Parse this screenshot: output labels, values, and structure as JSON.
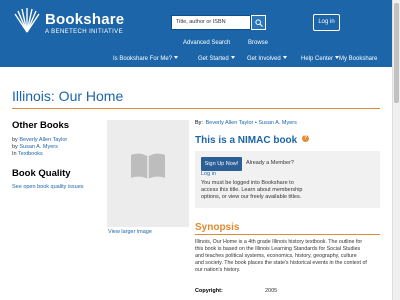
{
  "header": {
    "brand": "Bookshare",
    "tagline": "A BENETECH INITIATIVE",
    "search_placeholder": "Title, author or ISBN",
    "login_label": "Log in",
    "subnav": [
      "Advanced Search",
      "Browse"
    ],
    "nav": [
      {
        "label": "Is Bookshare For Me?",
        "dropdown": true
      },
      {
        "label": "Get Started",
        "dropdown": true
      },
      {
        "label": "Get Involved",
        "dropdown": true
      },
      {
        "label": "Help Center",
        "dropdown": true
      },
      {
        "label": "My Bookshare",
        "dropdown": false
      }
    ]
  },
  "page": {
    "title": "Illinois: Our Home"
  },
  "sidebar": {
    "other_books_heading": "Other Books",
    "other_books": [
      {
        "prefix": "by",
        "text": "Beverly Allen Taylor"
      },
      {
        "prefix": "by",
        "text": "Susan A. Myers"
      },
      {
        "prefix": "In",
        "text": "Textbooks"
      }
    ],
    "book_quality_heading": "Book Quality",
    "book_quality_link": "See open book quality issues"
  },
  "book": {
    "by_label": "By:",
    "authors": "Beverly Allen Taylor • Susan A. Myers",
    "view_large": "View larger image",
    "nimac_title": "This is a NIMAC book",
    "help_icon_text": "?",
    "signup_label": "Sign Up Now!",
    "already_member": "Already a Member?",
    "login_link": "Log in",
    "notice_lines": [
      "You must be logged into Bookshare to",
      "access this title. Learn about membership",
      "options, or view our freely available titles."
    ],
    "synopsis_heading": "Synopsis",
    "synopsis_lines": [
      "Illinois, Our Home is a 4th grade Illinois history textbook. The outline for",
      "this book is based on the Illinois Learning Standards for Social Studies",
      "and teaches political systems, economics, history, geography, culture",
      "and society. The book places the state's historical events in the context of",
      "our nation's history."
    ],
    "copyright_label": "Copyright:",
    "copyright_value": "2005"
  },
  "colors": {
    "header_blue": "#1c65a9",
    "accent_orange": "#e08a3c",
    "signup_button": "#2b5f95"
  }
}
